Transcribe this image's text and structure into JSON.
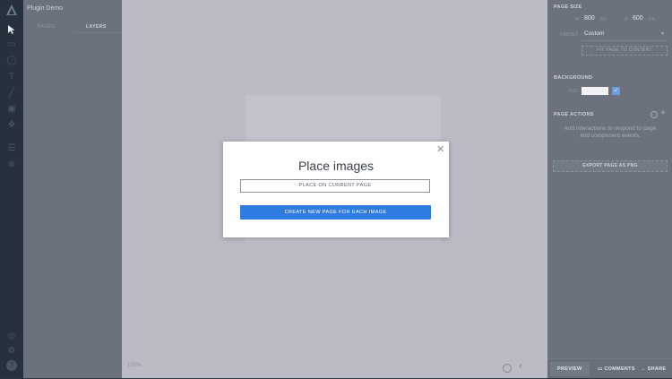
{
  "app": {
    "project_title": "Plugin Demo"
  },
  "left_panel": {
    "tabs": [
      {
        "label": "PAGES",
        "active": false
      },
      {
        "label": "LAYERS",
        "active": true
      }
    ]
  },
  "canvas": {
    "zoom": "100%"
  },
  "right_panel": {
    "page_size": {
      "title": "PAGE SIZE",
      "w_label": "W",
      "w_value": "800",
      "w_unit": "PX",
      "h_label": "H",
      "h_value": "600",
      "h_unit": "PX",
      "preset_label": "PRESET",
      "preset_value": "Custom",
      "fit_button": "FIT PAGE TO CONTENT"
    },
    "background": {
      "title": "BACKGROUND",
      "fill_label": "FILL",
      "fill_color": "#ffffff",
      "fill_enabled": true
    },
    "page_actions": {
      "title": "PAGE ACTIONS",
      "hint": "Add interactions to respond to page and component events."
    },
    "export_button": "EXPORT PAGE AS PNG",
    "bottom_bar": {
      "preview": "PREVIEW",
      "comments": "COMMENTS",
      "share": "SHARE"
    }
  },
  "modal": {
    "title": "Place images",
    "place_current_label": "PLACE ON CURRENT PAGE",
    "create_new_label": "CREATE NEW PAGE FOR EACH IMAGE",
    "close_icon": "close-icon",
    "accent_color": "#2f7be0"
  }
}
